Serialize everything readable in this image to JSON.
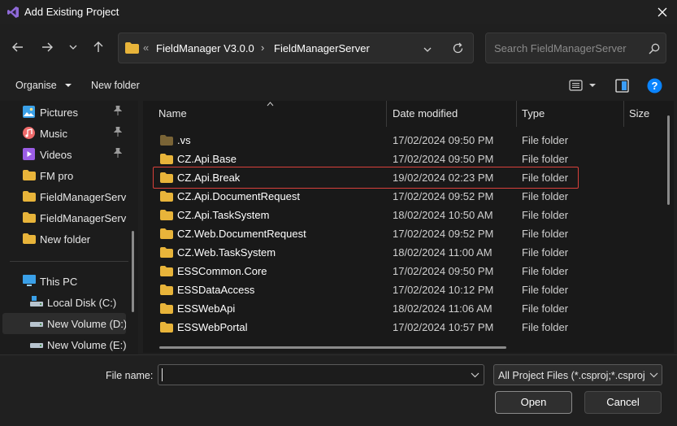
{
  "window": {
    "title": "Add Existing Project"
  },
  "navigation": {
    "breadcrumb_overflow": "«",
    "breadcrumb": [
      "FieldManager V3.0.0",
      "FieldManagerServer"
    ],
    "search_placeholder": "Search FieldManagerServer"
  },
  "commandbar": {
    "organise": "Organise",
    "new_folder": "New folder"
  },
  "navpane": {
    "items": [
      {
        "label": "Pictures",
        "icon": "pictures-icon",
        "pinned": true
      },
      {
        "label": "Music",
        "icon": "music-icon",
        "pinned": true
      },
      {
        "label": "Videos",
        "icon": "videos-icon",
        "pinned": true
      },
      {
        "label": "FM pro",
        "icon": "folder-icon",
        "pinned": false
      },
      {
        "label": "FieldManagerServ",
        "icon": "folder-icon",
        "pinned": false
      },
      {
        "label": "FieldManagerServ",
        "icon": "folder-icon",
        "pinned": false
      },
      {
        "label": "New folder",
        "icon": "folder-icon",
        "pinned": false
      },
      {
        "label": "This PC",
        "icon": "computer-icon",
        "pinned": false
      },
      {
        "label": "Local Disk (C:)",
        "icon": "drive-icon",
        "pinned": false
      },
      {
        "label": "New Volume (D:)",
        "icon": "drive-icon",
        "pinned": false
      },
      {
        "label": "New Volume (E:)",
        "icon": "drive-icon",
        "pinned": false
      }
    ]
  },
  "filelist": {
    "columns": [
      "Name",
      "Date modified",
      "Type",
      "Size"
    ],
    "rows": [
      {
        "name": ".vs",
        "date": "17/02/2024 09:50 PM",
        "type": "File folder"
      },
      {
        "name": "CZ.Api.Base",
        "date": "17/02/2024 09:50 PM",
        "type": "File folder"
      },
      {
        "name": "CZ.Api.Break",
        "date": "19/02/2024 02:23 PM",
        "type": "File folder"
      },
      {
        "name": "CZ.Api.DocumentRequest",
        "date": "17/02/2024 09:52 PM",
        "type": "File folder"
      },
      {
        "name": "CZ.Api.TaskSystem",
        "date": "18/02/2024 10:50 AM",
        "type": "File folder"
      },
      {
        "name": "CZ.Web.DocumentRequest",
        "date": "17/02/2024 09:52 PM",
        "type": "File folder"
      },
      {
        "name": "CZ.Web.TaskSystem",
        "date": "18/02/2024 11:00 AM",
        "type": "File folder"
      },
      {
        "name": "ESSCommon.Core",
        "date": "17/02/2024 09:50 PM",
        "type": "File folder"
      },
      {
        "name": "ESSDataAccess",
        "date": "17/02/2024 10:12 PM",
        "type": "File folder"
      },
      {
        "name": "ESSWebApi",
        "date": "18/02/2024 11:06 AM",
        "type": "File folder"
      },
      {
        "name": "ESSWebPortal",
        "date": "17/02/2024 10:57 PM",
        "type": "File folder"
      }
    ],
    "highlighted_row": "CZ.Api.Break"
  },
  "footer": {
    "file_name_label": "File name:",
    "file_name_value": "",
    "filter_value": "All Project Files (*.csproj;*.csproj",
    "open_label": "Open",
    "cancel_label": "Cancel"
  },
  "colors": {
    "background": "#1f1f1f",
    "folder": "#e8b43a",
    "accent": "#0a84ff",
    "highlight_border": "#d9403b"
  }
}
